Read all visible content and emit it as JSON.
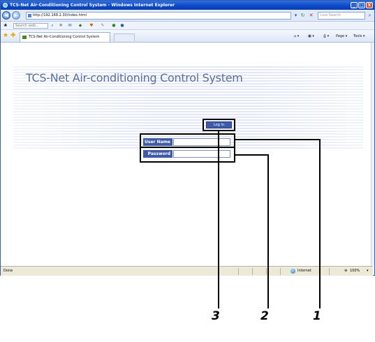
{
  "window": {
    "title": "TCS-Net Air-Conditioning Control System - Windows Internet Explorer",
    "controls": [
      "_",
      "□",
      "X"
    ]
  },
  "address_bar": {
    "url": "http://192.168.2.30/index.html",
    "search_placeholder": "Live Search",
    "back_glyph": "◀",
    "forward_glyph": "▶"
  },
  "toolbar": {
    "search_placeholder": "Search web...",
    "icons": [
      "search-icon",
      "highlight-icon",
      "mail-icon",
      "addon-icon",
      "feed-icon",
      "settings-icon",
      "help-icon"
    ]
  },
  "tab": {
    "label": "TCS-Net Air-Conditioning Control System",
    "page_menu": "Page",
    "tools_menu": "Tools"
  },
  "page": {
    "system_title": "TCS-Net Air-conditioning Control System",
    "user_name_label": "User Name",
    "user_name_value": "",
    "password_label": "Password",
    "password_value": "",
    "login_button": "Log in"
  },
  "status_bar": {
    "status": "Done",
    "zone": "Internet",
    "zoom": "100%"
  },
  "callouts": {
    "1": "1",
    "2": "2",
    "3": "3"
  }
}
